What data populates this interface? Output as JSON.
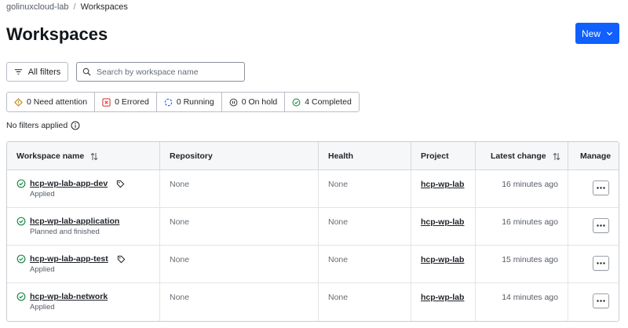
{
  "breadcrumb": {
    "org": "golinuxcloud-lab",
    "separator": "/",
    "current": "Workspaces"
  },
  "page": {
    "title": "Workspaces"
  },
  "toolbar": {
    "new_label": "New",
    "filters_label": "All filters",
    "search_placeholder": "Search by workspace name"
  },
  "status_filters": [
    {
      "label": "0 Need attention",
      "icon": "warning-diamond-icon",
      "color": "#c27a00"
    },
    {
      "label": "0 Errored",
      "icon": "error-x-icon",
      "color": "#d62e2e"
    },
    {
      "label": "0 Running",
      "icon": "running-circle-icon",
      "color": "#1060ff"
    },
    {
      "label": "0 On hold",
      "icon": "pause-circle-icon",
      "color": "#3b3d45"
    },
    {
      "label": "4 Completed",
      "icon": "check-circle-icon",
      "color": "#1f8a4c"
    }
  ],
  "filter_note": "No filters applied",
  "table": {
    "headers": [
      "Workspace name",
      "Repository",
      "Health",
      "Project",
      "Latest change",
      "Manage"
    ],
    "rows": [
      {
        "name": "hcp-wp-lab-app-dev",
        "tagged": true,
        "status": "Applied",
        "repository": "None",
        "health": "None",
        "project": "hcp-wp-lab",
        "latest_change": "16 minutes ago"
      },
      {
        "name": "hcp-wp-lab-application",
        "tagged": false,
        "status": "Planned and finished",
        "repository": "None",
        "health": "None",
        "project": "hcp-wp-lab",
        "latest_change": "16 minutes ago"
      },
      {
        "name": "hcp-wp-lab-app-test",
        "tagged": true,
        "status": "Applied",
        "repository": "None",
        "health": "None",
        "project": "hcp-wp-lab",
        "latest_change": "15 minutes ago"
      },
      {
        "name": "hcp-wp-lab-network",
        "tagged": false,
        "status": "Applied",
        "repository": "None",
        "health": "None",
        "project": "hcp-wp-lab",
        "latest_change": "14 minutes ago"
      }
    ]
  },
  "colors": {
    "accent": "#1060ff",
    "success": "#1f8a4c"
  }
}
